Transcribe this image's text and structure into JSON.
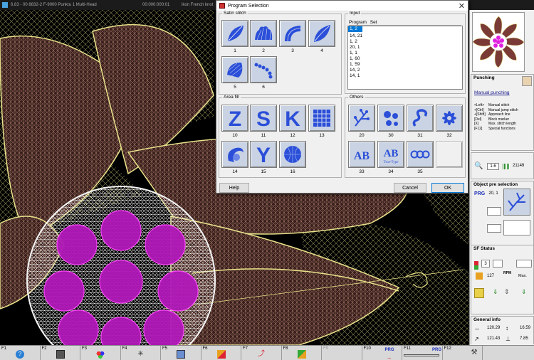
{
  "titlebar": {
    "left": "6.83 - 00 8832-2 F-9000 Punktu 1   Multi-Head",
    "mid": "00:000:000:01",
    "right": "ikon French knot"
  },
  "dialog": {
    "title": "Program Selection",
    "satin_label": "Satin stitch",
    "satin_nums": [
      "1",
      "2",
      "3",
      "4",
      "5",
      "6"
    ],
    "area_label": "Area fill",
    "area_nums": [
      "10",
      "11",
      "12",
      "13",
      "14",
      "15",
      "16"
    ],
    "input_label": "Input",
    "input_headers": [
      "Program",
      "Set"
    ],
    "input_value": "1, 2",
    "list": [
      "14, 21",
      "1, 2",
      "20, 1",
      "1, 1",
      "1, 60",
      "1, 59",
      "14, 2",
      "14, 1"
    ],
    "others_label": "Others",
    "others_nums": [
      "20",
      "30",
      "31",
      "32",
      "33",
      "34",
      "35"
    ],
    "help": "Help",
    "cancel": "Cancel",
    "ok": "OK"
  },
  "right_panel": {
    "punching_title": "Punching",
    "manual_punching": "Manual punching",
    "shortcuts": [
      [
        "<Left>",
        "Manual stitch"
      ],
      [
        "+[Ctrl]",
        "Manual jump stitch"
      ],
      [
        "+[Shift]",
        "Approach line"
      ],
      [
        "[Del]",
        "Block marker"
      ],
      [
        "[X]",
        "Max. stitch length"
      ],
      [
        "[F12]",
        "Special functions"
      ]
    ],
    "zoom": "1.6",
    "stitch_count": "21149",
    "object_pre_title": "Object pre selection",
    "prg_label": "PRG",
    "prg_value": "20, 1",
    "sf_status_title": "SF Status",
    "sf_value": "3",
    "sf_speed": "127",
    "sf_rpm": "RPM",
    "sf_max": "Max.",
    "general_title": "General info",
    "width": "120.29",
    "height": "16.59",
    "length": "121.43",
    "other": "7.85"
  },
  "fbar": [
    "F1",
    "F2",
    "F3",
    "F4",
    "F5",
    "F6",
    "F7",
    "F8",
    "F9",
    "F10",
    "F11",
    "F12"
  ],
  "colors": {
    "accent": "#0078d7",
    "tile_bg": "#c9d3e3",
    "stitch_blue": "#2b4fd8",
    "design_yellow": "#e8e28a",
    "design_magenta": "#e020e0",
    "design_brown": "#7a3a36"
  }
}
